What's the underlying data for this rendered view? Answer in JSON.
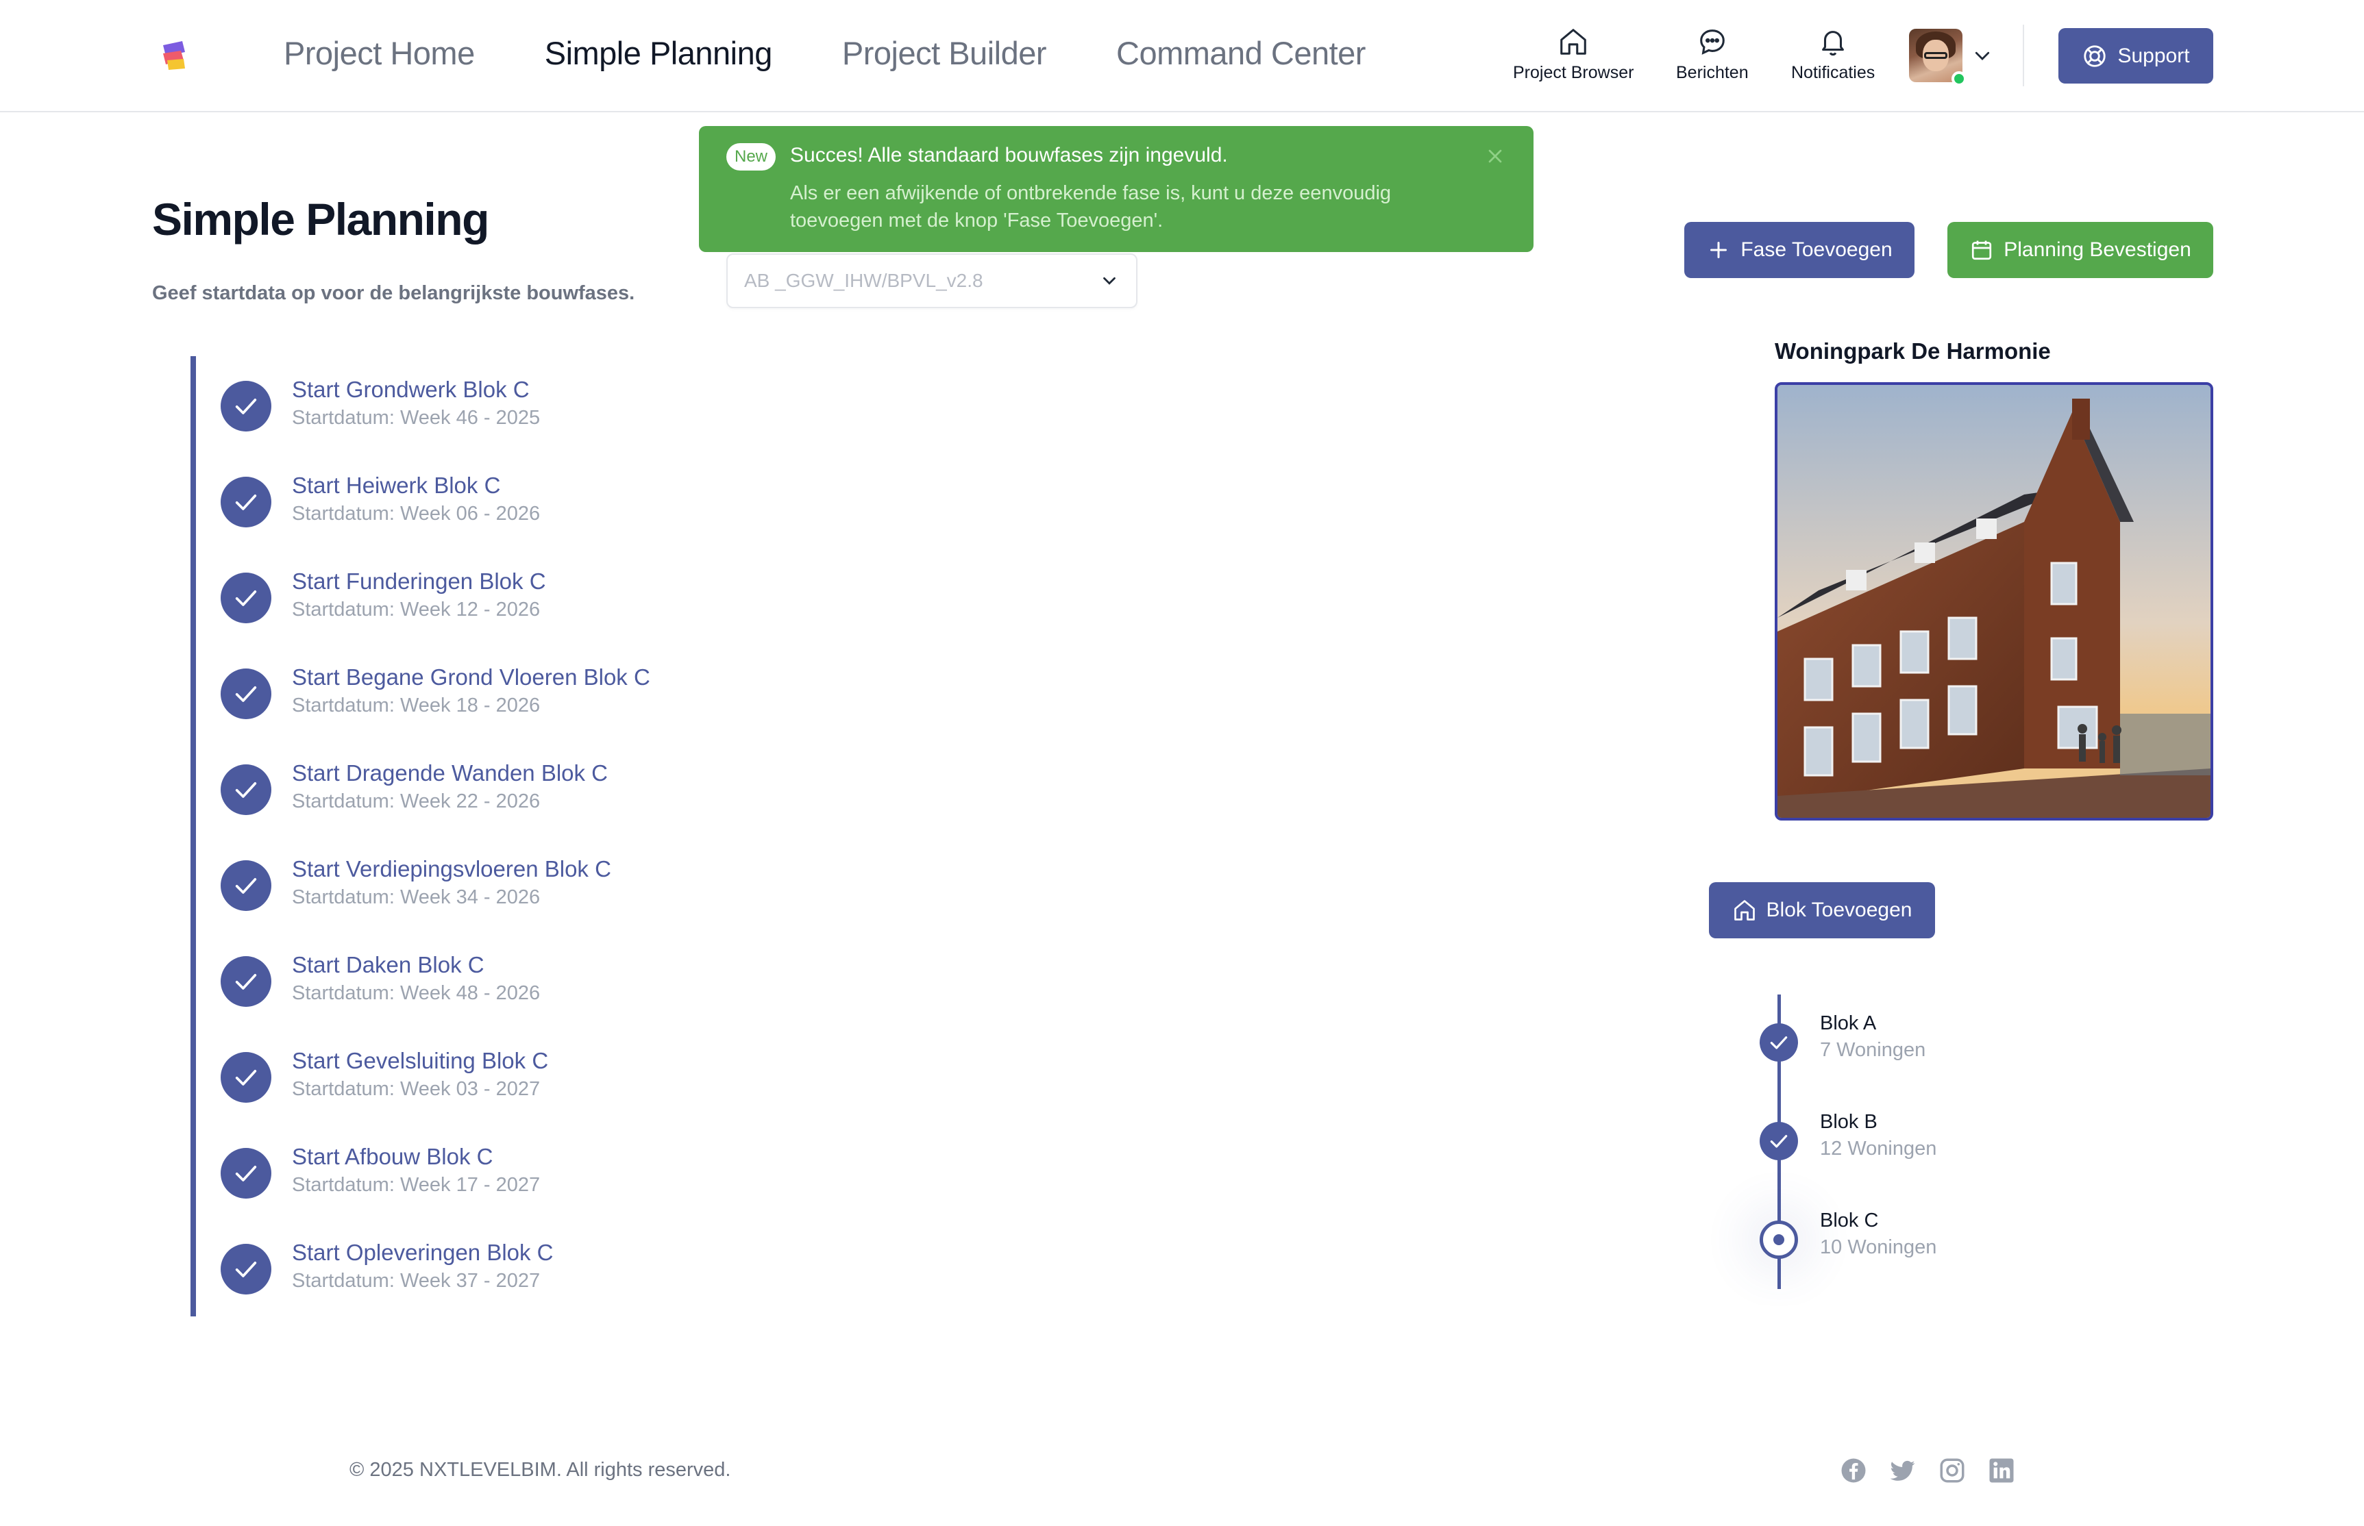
{
  "header": {
    "nav": [
      {
        "label": "Project Home",
        "active": false
      },
      {
        "label": "Simple Planning",
        "active": true
      },
      {
        "label": "Project Builder",
        "active": false
      },
      {
        "label": "Command Center",
        "active": false
      }
    ],
    "icons": {
      "project_browser": "Project Browser",
      "berichten": "Berichten",
      "notificaties": "Notificaties"
    },
    "support_label": "Support"
  },
  "toast": {
    "badge": "New",
    "title": "Succes! Alle standaard bouwfases zijn ingevuld.",
    "body": "Als er een afwijkende of ontbrekende fase is, kunt u deze eenvoudig toevoegen met de knop 'Fase Toevoegen'."
  },
  "page": {
    "title": "Simple Planning",
    "subtitle": "Geef startdata op voor de belangrijkste bouwfases.",
    "template_select": "AB _GGW_IHW/BPVL_v2.8"
  },
  "actions": {
    "add_phase": "Fase Toevoegen",
    "confirm_planning": "Planning Bevestigen",
    "add_block": "Blok Toevoegen"
  },
  "phases": [
    {
      "title": "Start Grondwerk Blok C",
      "date": "Startdatum: Week 46 - 2025"
    },
    {
      "title": "Start Heiwerk Blok C",
      "date": "Startdatum: Week 06 - 2026"
    },
    {
      "title": "Start Funderingen Blok C",
      "date": "Startdatum: Week 12 - 2026"
    },
    {
      "title": "Start Begane Grond Vloeren Blok C",
      "date": "Startdatum: Week 18 - 2026"
    },
    {
      "title": "Start Dragende Wanden Blok C",
      "date": "Startdatum: Week 22 - 2026"
    },
    {
      "title": "Start Verdiepingsvloeren Blok C",
      "date": "Startdatum: Week 34 - 2026"
    },
    {
      "title": "Start Daken Blok C",
      "date": "Startdatum: Week 48 - 2026"
    },
    {
      "title": "Start Gevelsluiting Blok C",
      "date": "Startdatum: Week 03 - 2027"
    },
    {
      "title": "Start Afbouw Blok C",
      "date": "Startdatum: Week 17 - 2027"
    },
    {
      "title": "Start Opleveringen Blok C",
      "date": "Startdatum: Week 37 - 2027"
    }
  ],
  "project": {
    "name": "Woningpark De Harmonie"
  },
  "blocks": [
    {
      "name": "Blok A",
      "count": "7 Woningen",
      "status": "done"
    },
    {
      "name": "Blok B",
      "count": "12 Woningen",
      "status": "done"
    },
    {
      "name": "Blok C",
      "count": "10 Woningen",
      "status": "current"
    }
  ],
  "footer": {
    "copyright": "© 2025 NXTLEVELBIM. All rights reserved."
  },
  "colors": {
    "primary": "#4c5a9e",
    "success": "#55a84c",
    "muted": "#9ca3af"
  }
}
